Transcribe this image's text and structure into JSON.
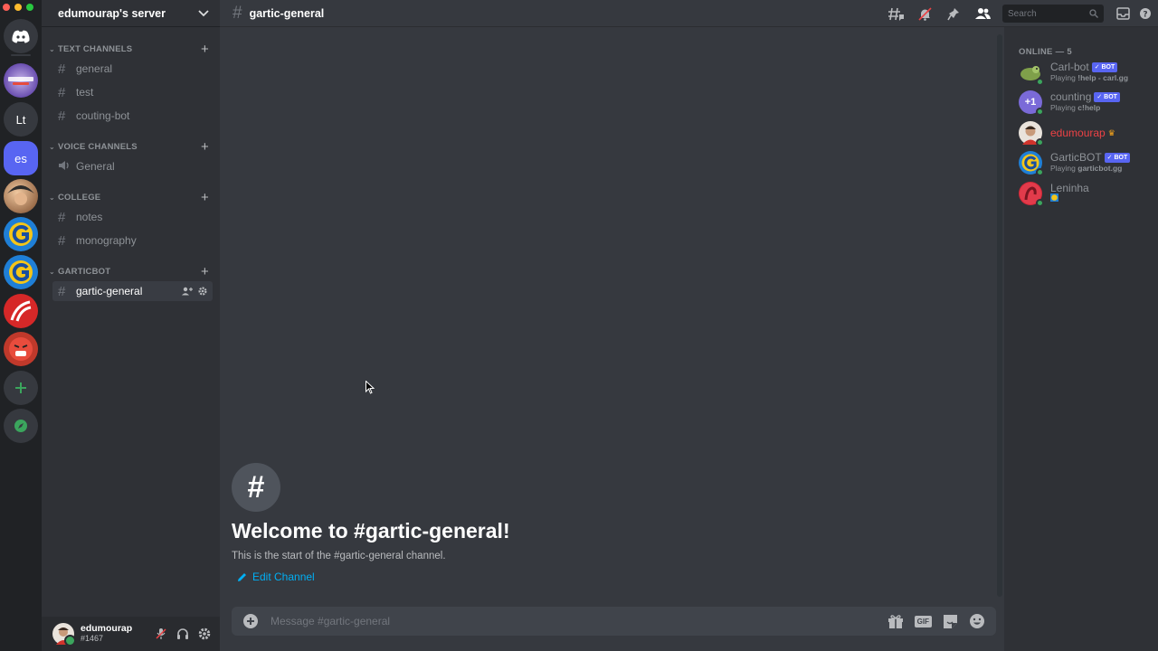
{
  "server": {
    "name": "edumourap's server",
    "categories": [
      {
        "name": "TEXT CHANNELS",
        "channels": [
          "general",
          "test",
          "couting-bot"
        ]
      },
      {
        "name": "VOICE CHANNELS",
        "channels": [
          "General"
        ]
      },
      {
        "name": "COLLEGE",
        "channels": [
          "notes",
          "monography"
        ]
      },
      {
        "name": "GARTICBOT",
        "channels": [
          "gartic-general"
        ]
      }
    ]
  },
  "guilds": {
    "lt": "Lt",
    "es": "es"
  },
  "user": {
    "name": "edumourap",
    "discriminator": "#1467"
  },
  "channel": {
    "name": "gartic-general",
    "welcome_title": "Welcome to #gartic-general!",
    "welcome_sub": "This is the start of the #gartic-general channel.",
    "edit_label": "Edit Channel",
    "composer_placeholder": "Message #gartic-general"
  },
  "search": {
    "placeholder": "Search"
  },
  "composer_tools": {
    "gif": "GIF"
  },
  "members": {
    "header": "ONLINE — 5",
    "bot_label": "✓ BOT",
    "list": [
      {
        "name": "Carl-bot",
        "status": "carl.gg",
        "status_prefix": "Playing",
        "status_bold": "!help -"
      },
      {
        "name": "counting",
        "status": "c!help",
        "status_prefix": "Playing",
        "status_bold": ""
      },
      {
        "name": "edumourap",
        "status": "",
        "status_prefix": "",
        "status_bold": ""
      },
      {
        "name": "GarticBOT",
        "status": "garticbot.gg",
        "status_prefix": "Playing",
        "status_bold": ""
      },
      {
        "name": "Leninha",
        "status": "",
        "status_prefix": "",
        "status_bold": ""
      }
    ],
    "counting_avatar": "+1"
  },
  "colors": {
    "accent": "#5865f2",
    "link": "#00aff4",
    "online": "#3ba55d",
    "owner_name": "#ed4245",
    "owner_crown": "#faa61a"
  }
}
